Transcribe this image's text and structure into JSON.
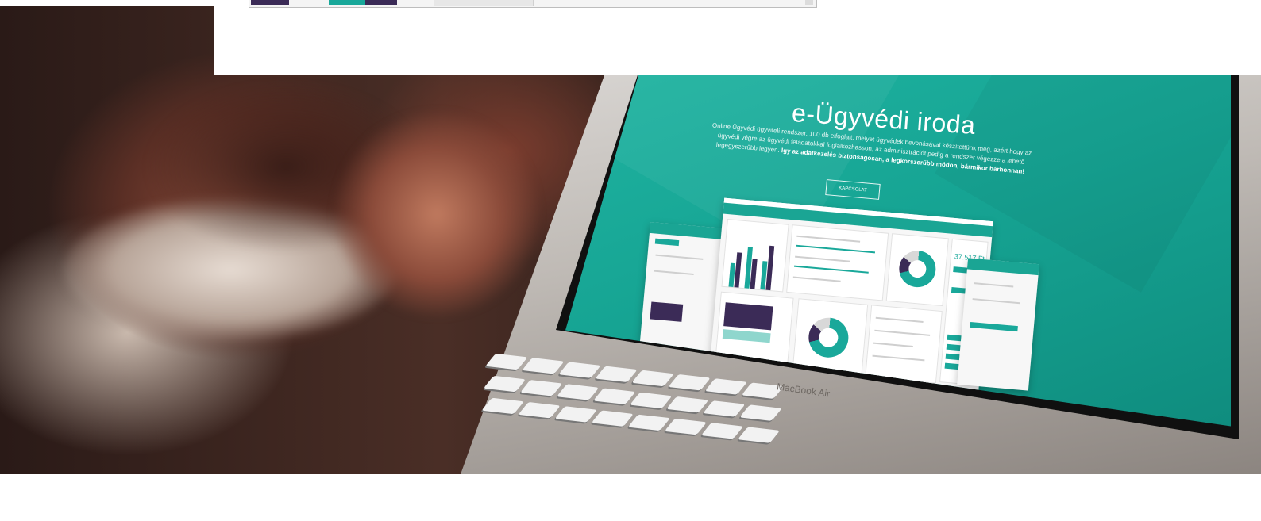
{
  "strip": {
    "colors": {
      "dark": "#3b2b57",
      "teal": "#19a89a",
      "light": "#e7e7e7"
    }
  },
  "laptop": {
    "screen": {
      "title": "e-Ügyvédi iroda",
      "text_line_1": "Online Ügyvédi ügyviteli rendszer, 100 db elfoglalt, melyet ügyvédek bevonásával készítettünk meg, azért hogy az ügyvédi",
      "text_line_2": "végre az ügyvédi feladatokkal foglalkozhasson, az adminisztrációt pedig a rendszer végezze a lehető legegyszerűbb legyen.",
      "text_bold": "Így az adatkezelés biztonságosan, a legkorszerűbb módon, bármikor bárhonnan!",
      "button_label": "KAPCSOLAT",
      "price_value": "37.517 Ft"
    },
    "brand": "MacBook Air"
  },
  "colors": {
    "accent": "#19a89a",
    "dark": "#3b2b57",
    "bg_teal": "#16a493"
  }
}
